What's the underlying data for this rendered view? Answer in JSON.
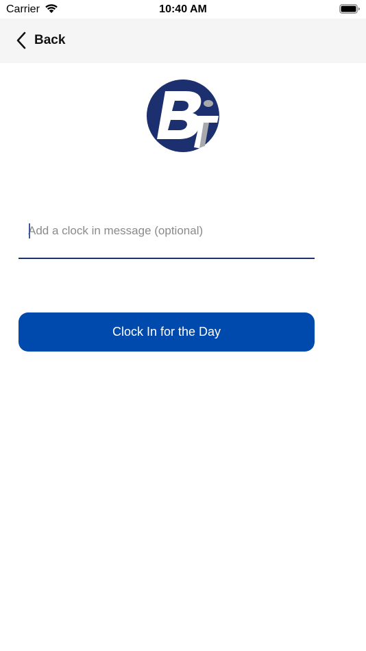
{
  "status_bar": {
    "carrier": "Carrier",
    "time": "10:40 AM",
    "wifi_icon": "wifi-icon",
    "battery_icon": "battery-icon"
  },
  "nav": {
    "back_label": "Back",
    "back_icon": "chevron-left-icon",
    "background": "#f5f5f5"
  },
  "logo": {
    "letters": "BT",
    "circle_color": "#1c2f6e"
  },
  "form": {
    "message_placeholder": "Add a clock in message (optional)",
    "message_value": "",
    "underline_color": "#1c2f6e"
  },
  "actions": {
    "clock_in_label": "Clock In for the Day",
    "button_color": "#004aad"
  }
}
